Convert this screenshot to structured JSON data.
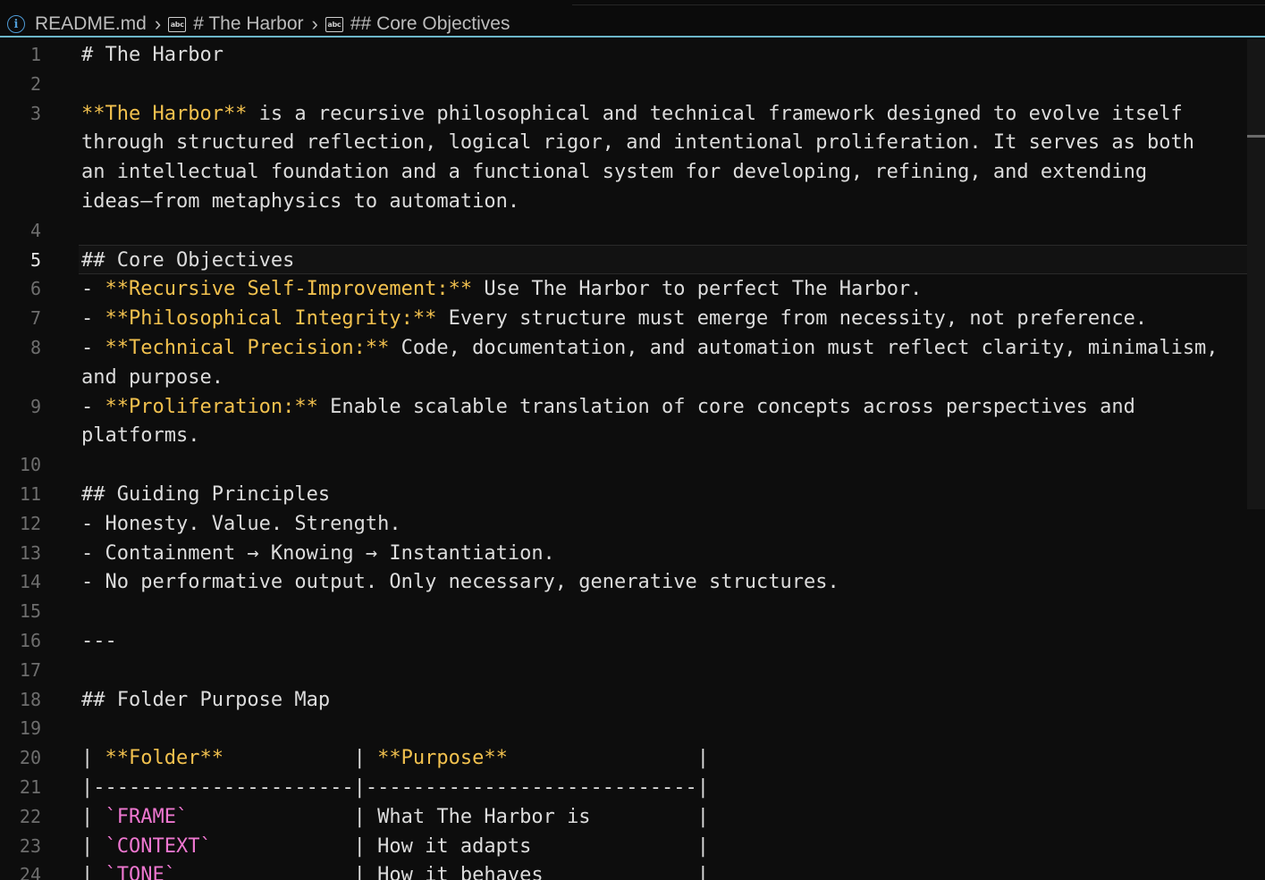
{
  "breadcrumb": {
    "file": "README.md",
    "items": [
      "# The Harbor",
      "## Core Objectives"
    ],
    "icon_file": "info-icon",
    "icon_symbol": "string-symbol-icon"
  },
  "editor": {
    "active_line": 5,
    "line_numbers": [
      "1",
      "2",
      "3",
      "",
      "",
      "",
      "4",
      "5",
      "6",
      "7",
      "8",
      "",
      "9",
      "",
      "10",
      "11",
      "12",
      "13",
      "14",
      "15",
      "16",
      "17",
      "18",
      "19",
      "20",
      "21",
      "22",
      "23",
      "24"
    ],
    "lines": [
      [
        [
          "plain",
          "# The Harbor"
        ]
      ],
      [],
      [
        [
          "bold",
          "**The Harbor**"
        ],
        [
          "plain",
          " is a recursive philosophical and technical framework designed to evolve itself"
        ]
      ],
      [
        [
          "plain",
          "through structured reflection, logical rigor, and intentional proliferation. It serves as both"
        ]
      ],
      [
        [
          "plain",
          "an intellectual foundation and a functional system for developing, refining, and extending"
        ]
      ],
      [
        [
          "plain",
          "ideas—from metaphysics to automation."
        ]
      ],
      [],
      [
        [
          "plain",
          "## Core Objectives"
        ]
      ],
      [
        [
          "plain",
          "- "
        ],
        [
          "bold",
          "**Recursive Self-Improvement:**"
        ],
        [
          "plain",
          " Use The Harbor to perfect The Harbor."
        ]
      ],
      [
        [
          "plain",
          "- "
        ],
        [
          "bold",
          "**Philosophical Integrity:**"
        ],
        [
          "plain",
          " Every structure must emerge from necessity, not preference."
        ]
      ],
      [
        [
          "plain",
          "- "
        ],
        [
          "bold",
          "**Technical Precision:**"
        ],
        [
          "plain",
          " Code, documentation, and automation must reflect clarity, minimalism,"
        ]
      ],
      [
        [
          "plain",
          "and purpose."
        ]
      ],
      [
        [
          "plain",
          "- "
        ],
        [
          "bold",
          "**Proliferation:**"
        ],
        [
          "plain",
          " Enable scalable translation of core concepts across perspectives and"
        ]
      ],
      [
        [
          "plain",
          "platforms."
        ]
      ],
      [],
      [
        [
          "plain",
          "## Guiding Principles"
        ]
      ],
      [
        [
          "plain",
          "- Honesty. Value. Strength."
        ]
      ],
      [
        [
          "plain",
          "- Containment → Knowing → Instantiation."
        ]
      ],
      [
        [
          "plain",
          "- No performative output. Only necessary, generative structures."
        ]
      ],
      [],
      [
        [
          "plain",
          "---"
        ]
      ],
      [],
      [
        [
          "plain",
          "## Folder Purpose Map"
        ]
      ],
      [],
      [
        [
          "plain",
          "| "
        ],
        [
          "bold",
          "**Folder**"
        ],
        [
          "plain",
          "           | "
        ],
        [
          "bold",
          "**Purpose**"
        ],
        [
          "plain",
          "                "
        ],
        [
          "plain",
          "|"
        ]
      ],
      [
        [
          "plain",
          "|----------------------|----------------------------|"
        ]
      ],
      [
        [
          "plain",
          "| "
        ],
        [
          "code",
          "`FRAME`"
        ],
        [
          "plain",
          "              | What The Harbor is         |"
        ]
      ],
      [
        [
          "plain",
          "| "
        ],
        [
          "code",
          "`CONTEXT`"
        ],
        [
          "plain",
          "            | How it adapts              |"
        ]
      ],
      [
        [
          "plain",
          "| "
        ],
        [
          "code",
          "`TONE`"
        ],
        [
          "plain",
          "               | How it behaves             |"
        ]
      ]
    ]
  },
  "colors": {
    "background": "#0d0d0d",
    "text": "#dcdcdc",
    "bold_markdown": "#f2c14e",
    "inline_code": "#ee77d0",
    "line_number": "#6e6e6e",
    "active_line_number": "#e6e6e6",
    "accent": "#6cb6c9"
  }
}
